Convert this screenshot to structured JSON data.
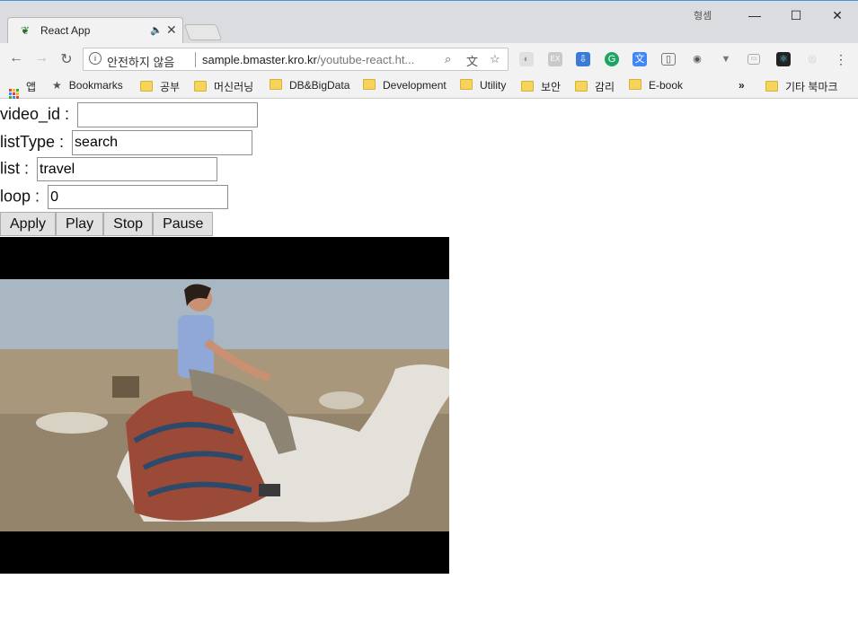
{
  "browser": {
    "tab_title": "React App",
    "profile_name": "형셈",
    "address": {
      "security_label": "안전하지 않음",
      "url_host": "sample.bmaster.kro.kr",
      "url_path": "/youtube-react.ht..."
    },
    "bookmarks": [
      {
        "label": "앱",
        "icon": "apps-icon"
      },
      {
        "label": "Bookmarks",
        "icon": "star-icon"
      },
      {
        "label": "공부",
        "icon": "folder-icon"
      },
      {
        "label": "머신러닝",
        "icon": "folder-icon"
      },
      {
        "label": "DB&BigData",
        "icon": "folder-icon"
      },
      {
        "label": "Development",
        "icon": "folder-icon"
      },
      {
        "label": "Utility",
        "icon": "folder-icon"
      },
      {
        "label": "보안",
        "icon": "folder-icon"
      },
      {
        "label": "감리",
        "icon": "folder-icon"
      },
      {
        "label": "E-book",
        "icon": "folder-icon"
      }
    ],
    "overflow_label": "»",
    "other_bookmarks": "기타 북마크",
    "accent_color": "#4a90e2"
  },
  "form": {
    "video_id": {
      "label": "video_id :",
      "value": ""
    },
    "listType": {
      "label": "listType :",
      "value": "search"
    },
    "list": {
      "label": "list :",
      "value": "travel"
    },
    "loop": {
      "label": "loop :",
      "value": "0"
    }
  },
  "buttons": {
    "apply": "Apply",
    "play": "Play",
    "stop": "Stop",
    "pause": "Pause"
  }
}
